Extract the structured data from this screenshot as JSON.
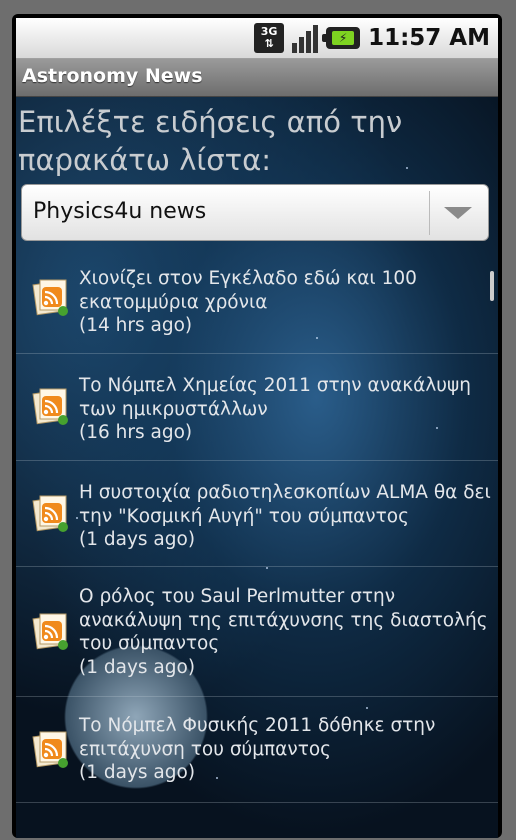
{
  "status": {
    "network": "3G",
    "time": "11:57 AM",
    "battery_glyph": "⚡"
  },
  "app": {
    "title": "Astronomy News"
  },
  "prompt": "Επιλέξτε ειδήσεις από την παρακάτω λίστα:",
  "spinner": {
    "selected": "Physics4u news"
  },
  "news": [
    {
      "title": "Χιονίζει στον Εγκέλαδο εδώ και 100 εκατομμύρια χρόνια",
      "age": "(14 hrs ago)"
    },
    {
      "title": "Το Νόμπελ Χημείας 2011 στην ανακάλυψη των ημικρυστάλλων",
      "age": "(16 hrs ago)"
    },
    {
      "title": "Η συστοιχία ραδιοτηλεσκοπίων ALMA θα δει την \"Κοσμική Αυγή\" του σύμπαντος",
      "age": "(1 days ago)"
    },
    {
      "title": "Ο ρόλος του Saul Perlmutter στην ανακάλυψη της επιτάχυνσης της διαστολής του σύμπαντος",
      "age": "(1 days ago)"
    },
    {
      "title": "Το Νόμπελ Φυσικής 2011 δόθηκε στην επιτάχυνση του σύμπαντος",
      "age": "(1 days ago)"
    }
  ]
}
